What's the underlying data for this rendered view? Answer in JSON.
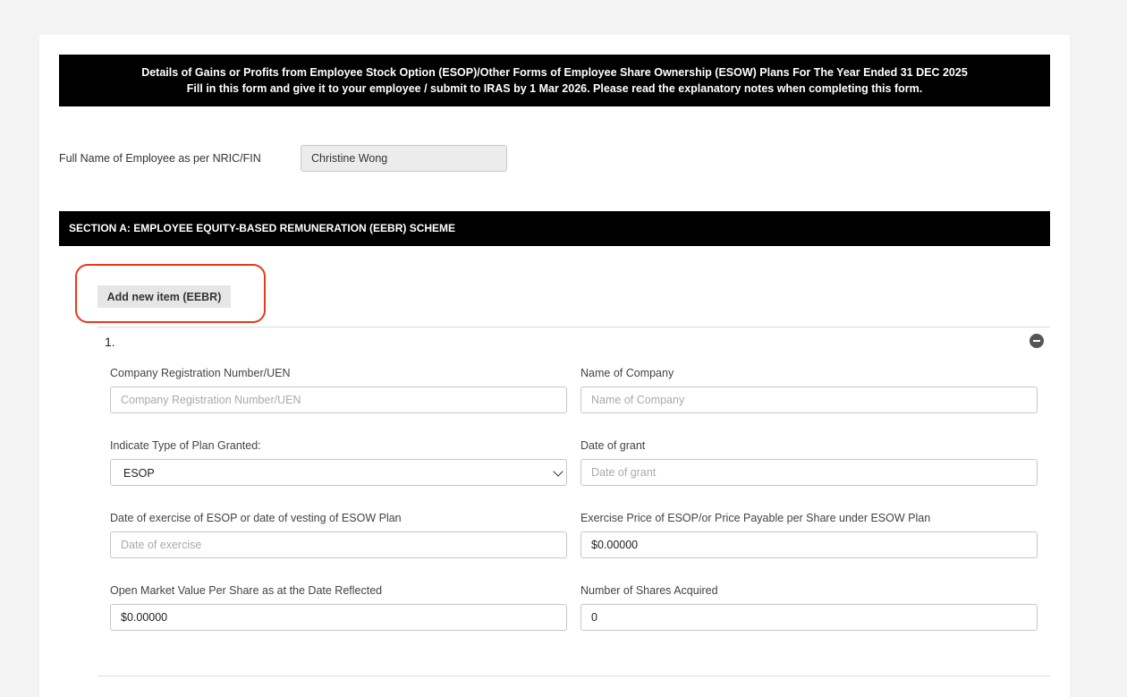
{
  "banner": {
    "line1": "Details of Gains or Profits from Employee Stock Option (ESOP)/Other Forms of Employee Share Ownership (ESOW) Plans For The Year Ended 31 DEC 2025",
    "line2": "Fill in this form and give it to your employee / submit to IRAS by 1 Mar 2026. Please read the explanatory notes when completing this form."
  },
  "employee": {
    "name_label": "Full Name of Employee as per NRIC/FIN",
    "name_value": "Christine Wong"
  },
  "section_a": {
    "title": "SECTION A: EMPLOYEE EQUITY-BASED REMUNERATION (EEBR) SCHEME",
    "add_button_label": "Add new item (EEBR)",
    "highlight_color": "#e8391c"
  },
  "item": {
    "number": "1.",
    "remove_icon": "minus-circle-icon",
    "fields": {
      "uen": {
        "label": "Company Registration Number/UEN",
        "placeholder": "Company Registration Number/UEN",
        "value": ""
      },
      "company_name": {
        "label": "Name of Company",
        "placeholder": "Name of Company",
        "value": ""
      },
      "plan_type": {
        "label": "Indicate Type of Plan Granted:",
        "value": "ESOP"
      },
      "grant_date": {
        "label": "Date of grant",
        "placeholder": "Date of grant",
        "value": ""
      },
      "exercise_date": {
        "label": "Date of exercise of ESOP or date of vesting of ESOW Plan",
        "placeholder": "Date of exercise",
        "value": ""
      },
      "exercise_price": {
        "label": "Exercise Price of ESOP/or Price Payable per Share under ESOW Plan",
        "value": "$0.00000"
      },
      "market_value": {
        "label": "Open Market Value Per Share as at the Date Reflected",
        "value": "$0.00000"
      },
      "shares_acquired": {
        "label": "Number of Shares Acquired",
        "value": "0"
      }
    }
  }
}
